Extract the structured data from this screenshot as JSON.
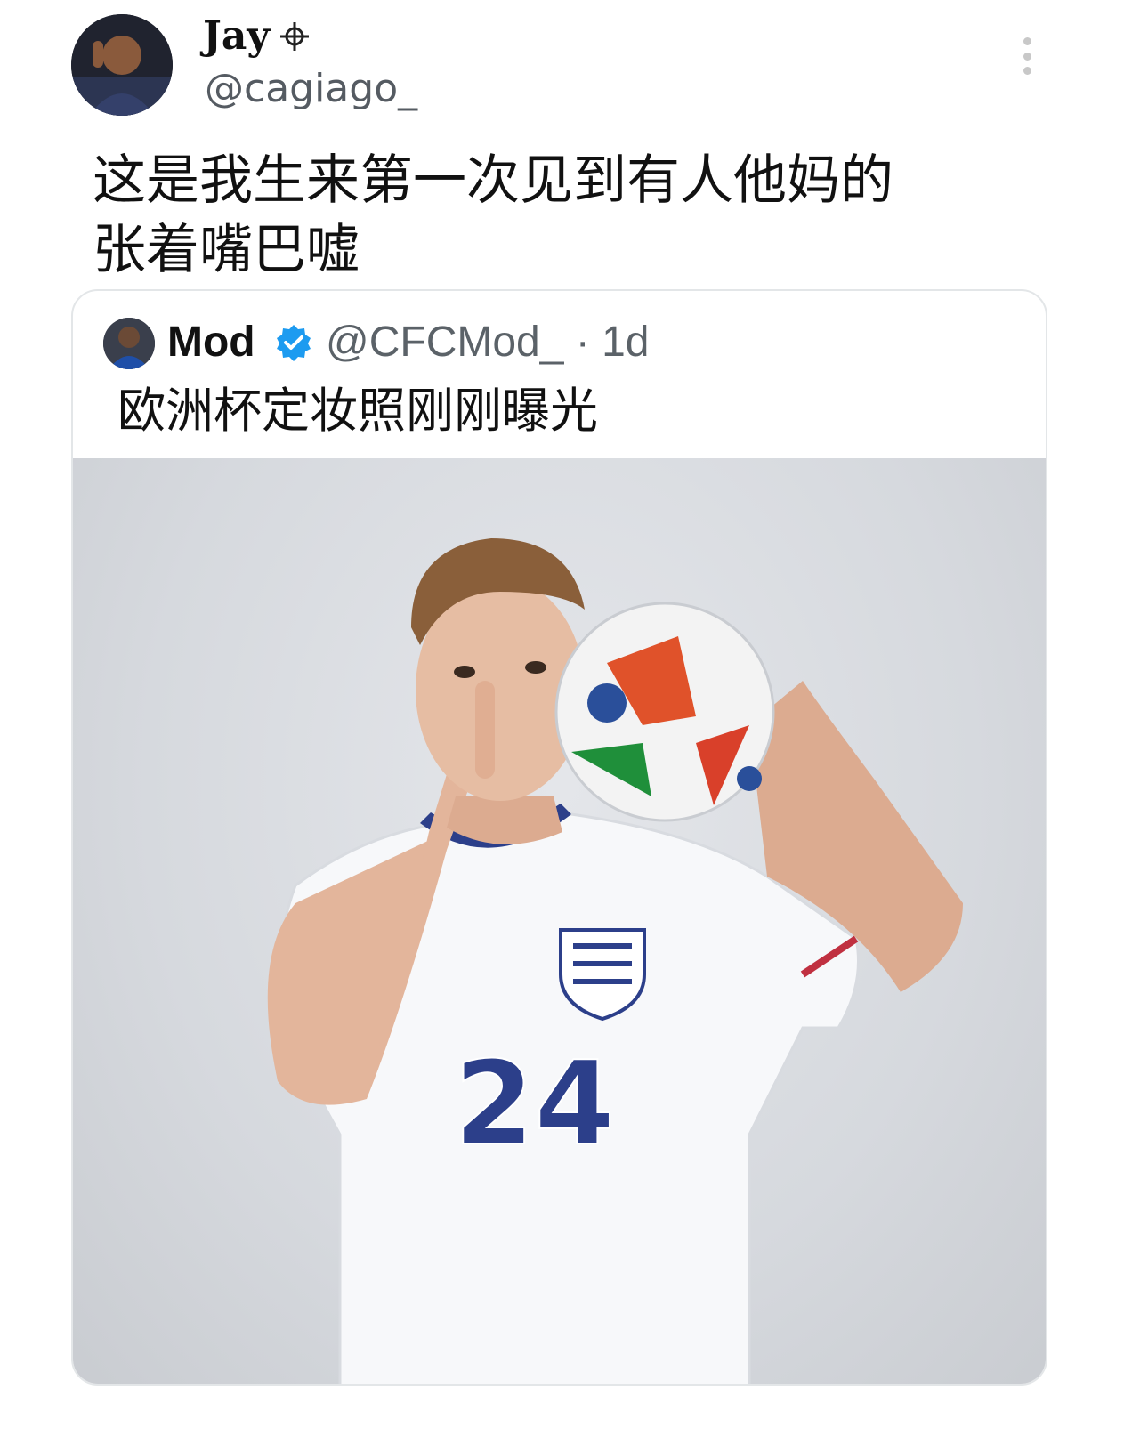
{
  "tweet": {
    "author": {
      "display_name": "Jay",
      "handle": "@cagiago_",
      "name_badge_icon": "crosshair-icon"
    },
    "text_lines": [
      "这是我生来第一次见到有人他妈的",
      "张着嘴巴嘘"
    ],
    "more_icon": "vertical-ellipsis-icon"
  },
  "quoted_tweet": {
    "author": {
      "display_name": "Mod",
      "verified_icon": "verified-badge-icon",
      "verified_color": "#1d9bf0"
    },
    "meta": "@CFCMod_ · 1d",
    "text": "欧洲杯定妆照刚刚曝光",
    "media": {
      "description_icon": "photo-image",
      "jersey_number": "24"
    }
  }
}
